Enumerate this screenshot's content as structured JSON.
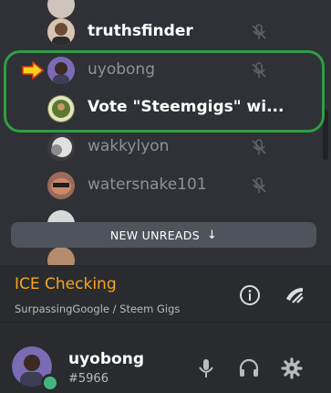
{
  "members": [
    {
      "name": "truthsfinder",
      "style": "bright",
      "avatar": "#8a6e5a"
    },
    {
      "name": "uyobong",
      "style": "dim",
      "avatar": "#7b6bb4"
    },
    {
      "name": "Vote \"Steemgigs\" wi...",
      "style": "bright",
      "avatar": "#6d8a3a"
    },
    {
      "name": "wakkylyon",
      "style": "dim",
      "avatar": "#d8d8d8"
    },
    {
      "name": "watersnake101",
      "style": "dim",
      "avatar": "#9a6a5a"
    }
  ],
  "new_unreads": {
    "label": "NEW UNREADS"
  },
  "voice": {
    "status": "ICE Checking",
    "channel": "SurpassingGoogle / Steem Gigs"
  },
  "user": {
    "name": "uyobong",
    "tag": "#5966"
  },
  "colors": {
    "background": "#2f3136",
    "panel": "#292b2f",
    "highlight": "#2f9e45",
    "voice_status": "#faa61a",
    "online": "#43b581",
    "arrow": "#f7d21b"
  }
}
